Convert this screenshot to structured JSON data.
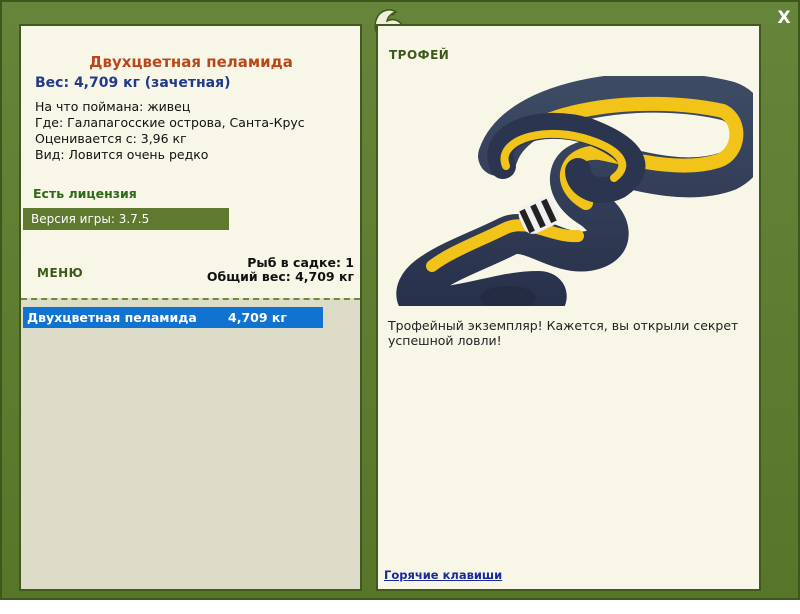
{
  "close_label": "X",
  "fish": {
    "name": "Двухцветная пеламида",
    "weight_line": "Вес: 4,709 кг (зачетная)",
    "caught_on": "На что поймана: живец",
    "location": "Где: Галапагосские острова, Санта-Крус",
    "valued_from": "Оценивается с: 3,96 кг",
    "rarity": "Вид: Ловится очень редко"
  },
  "license": "Есть лицензия",
  "version": "Версия игры: 3.7.5",
  "menu_label": "МЕНЮ",
  "keepnet": {
    "count_line": "Рыб в садке: 1",
    "total_line": "Общий вес: 4,709 кг"
  },
  "catch_list": [
    {
      "name": "Двухцветная пеламида",
      "weight": "4,709 кг"
    }
  ],
  "trophy": {
    "title": "ТРОФЕЙ",
    "text": "Трофейный экземпляр! Кажется, вы открыли секрет успешной ловли!",
    "hotkeys": "Горячие клавиши"
  },
  "colors": {
    "frame": "#5e7a2c",
    "panel": "#f7f6e7",
    "fish_name": "#b8481c",
    "weight": "#213a8a",
    "license": "#2e6a17",
    "selected_row": "#1073d1"
  }
}
